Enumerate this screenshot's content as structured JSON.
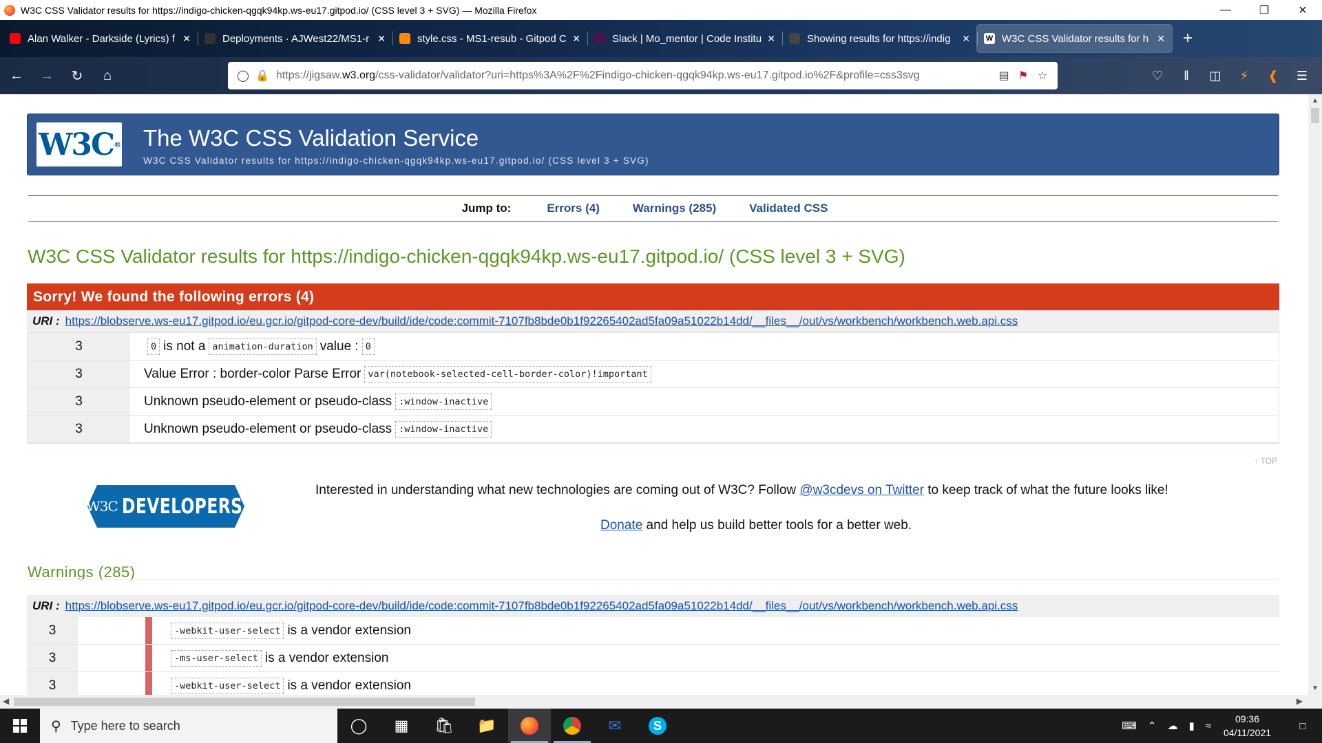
{
  "window": {
    "title": "W3C CSS Validator results for https://indigo-chicken-qgqk94kp.ws-eu17.gitpod.io/ (CSS level 3 + SVG) — Mozilla Firefox"
  },
  "tabs": [
    {
      "label": "Alan Walker - Darkside (Lyrics) f",
      "icon": "youtube-icon",
      "color": "#ff0000"
    },
    {
      "label": "Deployments · AJWest22/MS1-r",
      "icon": "github-icon",
      "color": "#333333"
    },
    {
      "label": "style.css - MS1-resub - Gitpod C",
      "icon": "gitpod-icon",
      "color": "#ff8a00"
    },
    {
      "label": "Slack | Mo_mentor | Code Institu",
      "icon": "slack-icon",
      "color": "#4a154b"
    },
    {
      "label": "Showing results for https://indig",
      "icon": "nu-validator-icon",
      "color": "#444444"
    },
    {
      "label": "W3C CSS Validator results for h",
      "icon": "w3c-icon",
      "color": "#ffffff"
    }
  ],
  "navbar": {
    "url_prefix": "https://jigsaw.",
    "url_domain": "w3.org",
    "url_rest": "/css-validator/validator?uri=https%3A%2F%2Findigo-chicken-qgqk94kp.ws-eu17.gitpod.io%2F&profile=css3svg"
  },
  "banner": {
    "logo_text": "W3C",
    "title": "The W3C CSS Validation Service",
    "subtitle": "W3C CSS Validator results for https://indigo-chicken-qgqk94kp.ws-eu17.gitpod.io/ (CSS level 3 + SVG)"
  },
  "jump": {
    "label": "Jump to:",
    "errors": "Errors (4)",
    "warnings": "Warnings (285)",
    "validated": "Validated CSS"
  },
  "results_title": "W3C CSS Validator results for https://indigo-chicken-qgqk94kp.ws-eu17.gitpod.io/ (CSS level 3 + SVG)",
  "errors": {
    "heading": "Sorry! We found the following errors (4)",
    "uri_label": "URI :",
    "uri": "https://blobserve.ws-eu17.gitpod.io/eu.gcr.io/gitpod-core-dev/build/ide/code:commit-7107fb8bde0b1f92265402ad5fa09a51022b14dd/__files__/out/vs/workbench/workbench.web.api.css",
    "rows": [
      {
        "line": "3",
        "parts": [
          [
            "code",
            "0"
          ],
          [
            "text",
            "is not a"
          ],
          [
            "code",
            "animation-duration"
          ],
          [
            "text",
            "value :"
          ],
          [
            "code",
            "0"
          ]
        ]
      },
      {
        "line": "3",
        "parts": [
          [
            "text",
            "Value Error : border-color Parse Error"
          ],
          [
            "code",
            "var(notebook-selected-cell-border-color)!important"
          ]
        ]
      },
      {
        "line": "3",
        "parts": [
          [
            "text",
            "Unknown pseudo-element or pseudo-class"
          ],
          [
            "code",
            ":window-inactive"
          ]
        ]
      },
      {
        "line": "3",
        "parts": [
          [
            "text",
            "Unknown pseudo-element or pseudo-class"
          ],
          [
            "code",
            ":window-inactive"
          ]
        ]
      }
    ]
  },
  "top_link": "↑ TOP",
  "developers": {
    "logo_prefix": "W3C",
    "logo_text": "DEVELOPERS",
    "text_before": "Interested in understanding what new technologies are coming out of W3C? Follow ",
    "twitter_link": "@w3cdevs on Twitter",
    "text_after": " to keep track of what the future looks like!",
    "donate_link": "Donate",
    "donate_text": " and help us build better tools for a better web."
  },
  "warnings": {
    "heading": "Warnings (285)",
    "uri_label": "URI :",
    "uri": "https://blobserve.ws-eu17.gitpod.io/eu.gcr.io/gitpod-core-dev/build/ide/code:commit-7107fb8bde0b1f92265402ad5fa09a51022b14dd/__files__/out/vs/workbench/workbench.web.api.css",
    "rows": [
      {
        "line": "3",
        "code": "-webkit-user-select",
        "text": "is a vendor extension"
      },
      {
        "line": "3",
        "code": "-ms-user-select",
        "text": "is a vendor extension"
      },
      {
        "line": "3",
        "code": "-webkit-user-select",
        "text": "is a vendor extension"
      }
    ]
  },
  "taskbar": {
    "search_placeholder": "Type here to search",
    "time": "09:36",
    "date": "04/11/2021"
  },
  "colors": {
    "banner_bg": "#315890",
    "error_header": "#d43c1b",
    "results_green": "#5e9626",
    "link_blue": "#1a52a8",
    "warning_bar": "#d76565"
  }
}
